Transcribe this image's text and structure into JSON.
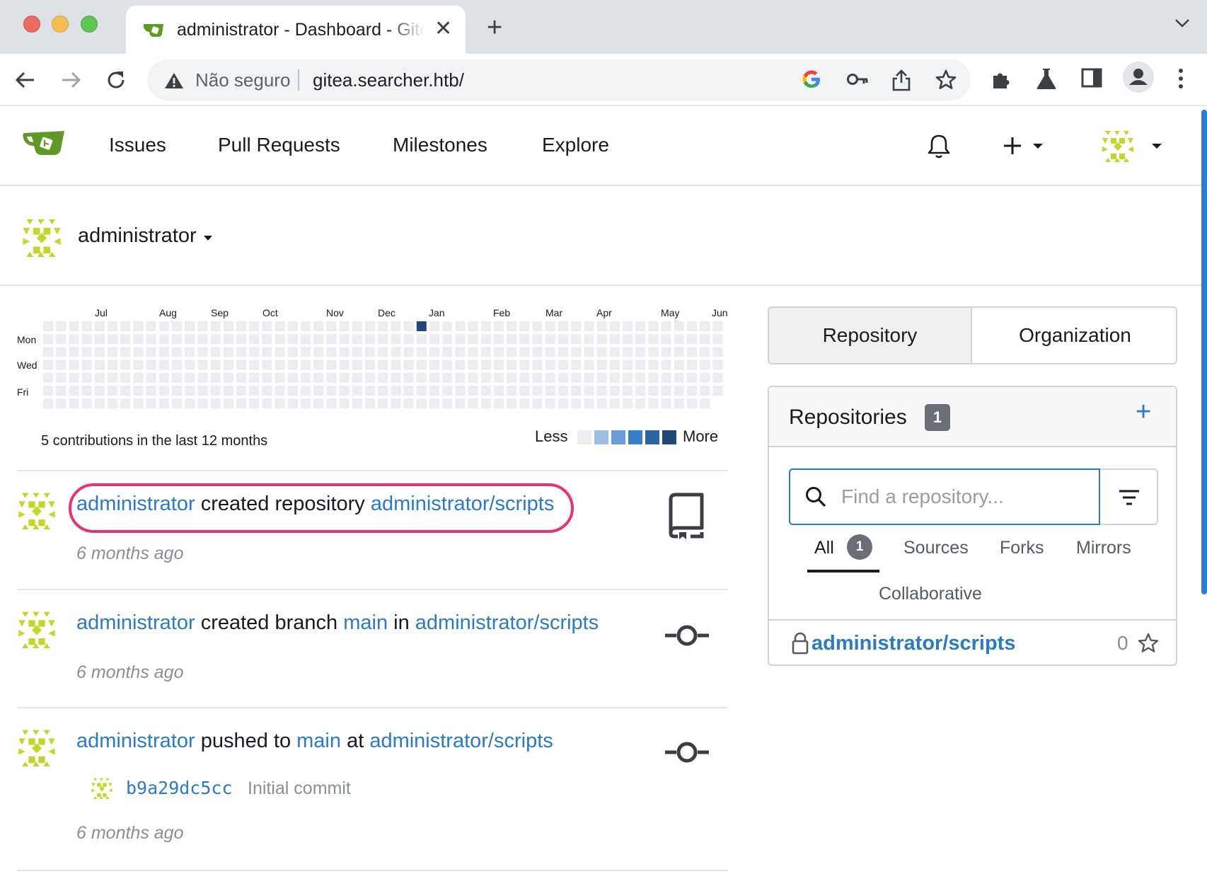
{
  "browser": {
    "tab_title": "administrator - Dashboard - Gitea",
    "security_label": "Não seguro",
    "url": "gitea.searcher.htb/"
  },
  "nav": {
    "issues": "Issues",
    "pull_requests": "Pull Requests",
    "milestones": "Milestones",
    "explore": "Explore"
  },
  "context": {
    "user": "administrator"
  },
  "heatmap": {
    "months": [
      "Jul",
      "Aug",
      "Sep",
      "Oct",
      "Nov",
      "Dec",
      "Jan",
      "Feb",
      "Mar",
      "Apr",
      "May",
      "Jun"
    ],
    "days": [
      "Mon",
      "Wed",
      "Fri"
    ],
    "total": "5 contributions in the last 12 months",
    "less": "Less",
    "more": "More",
    "active_cell": {
      "week": 29,
      "day": 0
    },
    "colors": [
      "#ebedf0",
      "#9ebfe3",
      "#6c9fd6",
      "#3d7fc7",
      "#2d64a3",
      "#1d4878"
    ]
  },
  "feed": [
    {
      "actor": "administrator",
      "action": "created repository",
      "repo": "administrator/scripts",
      "time": "6 months ago",
      "icon": "repo-icon"
    },
    {
      "actor": "administrator",
      "action": "created branch",
      "branch": "main",
      "connector": "in",
      "repo": "administrator/scripts",
      "time": "6 months ago",
      "icon": "git-commit-icon"
    },
    {
      "actor": "administrator",
      "action": "pushed to",
      "branch": "main",
      "connector": "at",
      "repo": "administrator/scripts",
      "commit_sha": "b9a29dc5cc",
      "commit_message": "Initial commit",
      "time": "6 months ago",
      "icon": "git-commit-icon"
    }
  ],
  "switcher": {
    "repository": "Repository",
    "organization": "Organization"
  },
  "repos": {
    "title": "Repositories",
    "count": "1",
    "add": "+",
    "search_placeholder": "Find a repository...",
    "tabs": {
      "all": "All",
      "all_count": "1",
      "sources": "Sources",
      "forks": "Forks",
      "mirrors": "Mirrors",
      "collaborative": "Collaborative"
    },
    "items": [
      {
        "name": "administrator/scripts",
        "stars": "0"
      }
    ]
  },
  "accent_color": "#2a7bc4",
  "highlight_color": "#e8336d"
}
